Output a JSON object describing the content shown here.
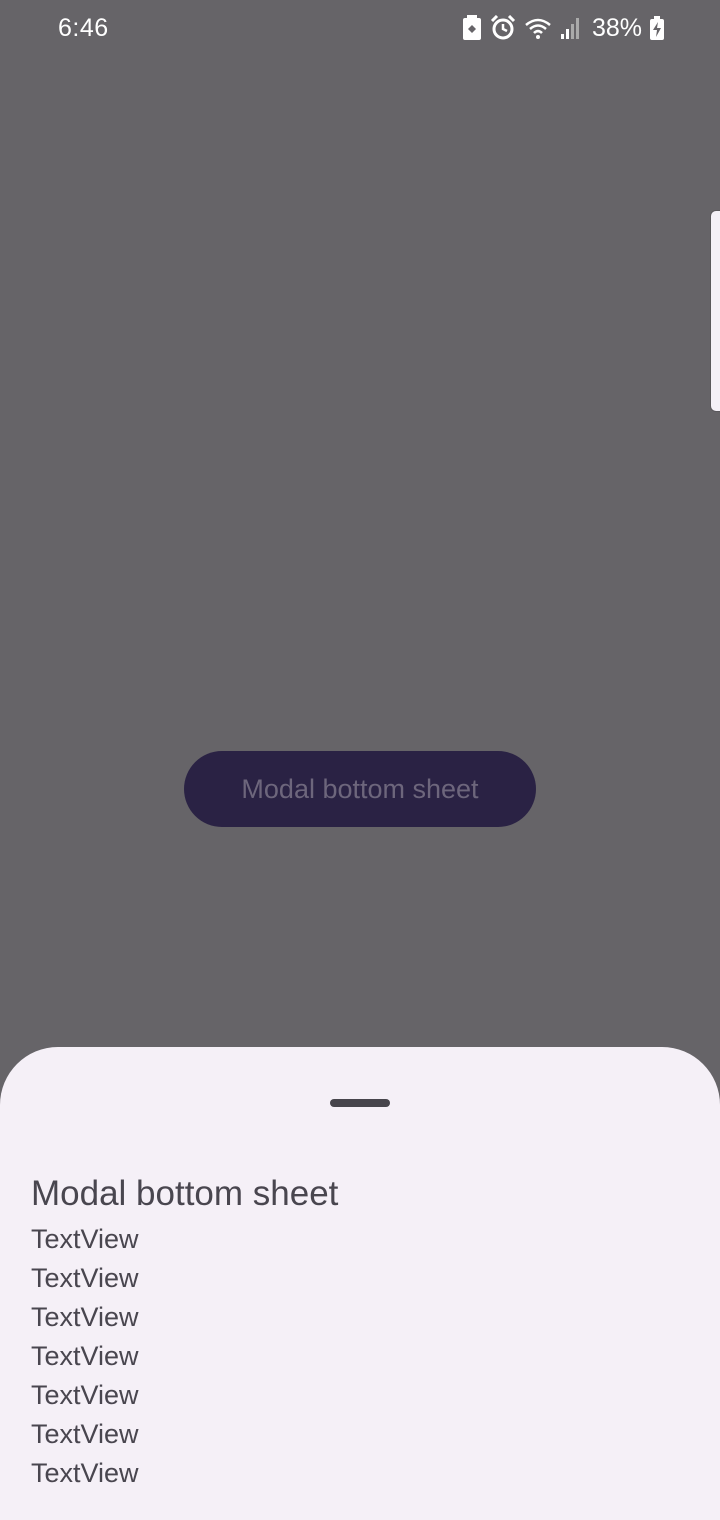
{
  "status_bar": {
    "time": "6:46",
    "battery": "38%",
    "icons": [
      "battery-saver-icon",
      "alarm-icon",
      "wifi-icon",
      "signal-icon",
      "battery-charging-icon"
    ]
  },
  "main": {
    "button_label": "Modal bottom sheet"
  },
  "sheet": {
    "title": "Modal bottom sheet",
    "items": [
      "TextView",
      "TextView",
      "TextView",
      "TextView",
      "TextView",
      "TextView",
      "TextView"
    ]
  },
  "colors": {
    "scrim": "#666468",
    "button_bg": "#2a2244",
    "sheet_bg": "#f5f0f7",
    "text": "#49464f"
  }
}
